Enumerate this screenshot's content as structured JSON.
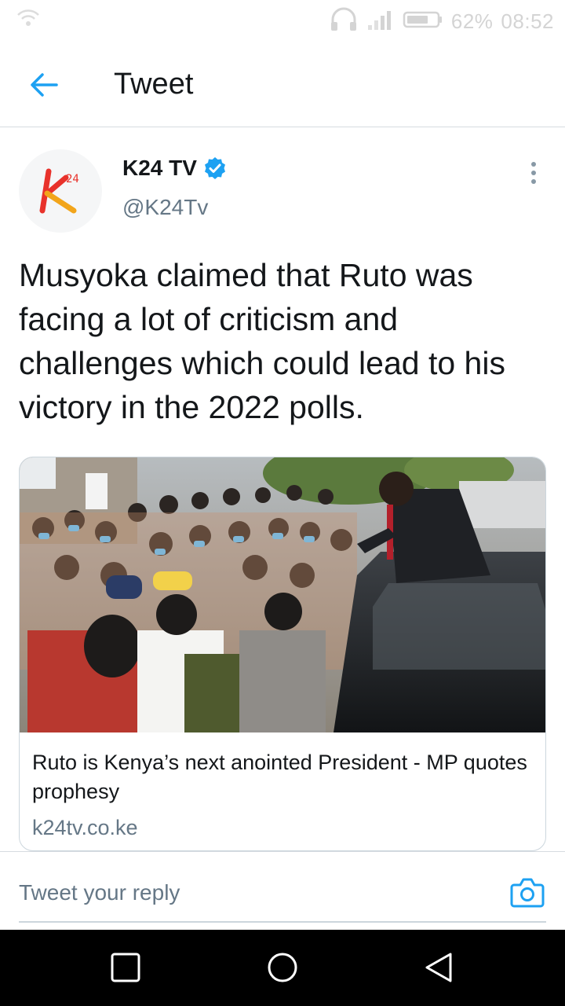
{
  "status_bar": {
    "battery": "62%",
    "time": "08:52",
    "icons": [
      "hotspot-icon",
      "headset-icon",
      "signal-icon",
      "battery-icon"
    ]
  },
  "header": {
    "title": "Tweet",
    "back_icon": "arrow-left-icon"
  },
  "tweet": {
    "author_name": "K24 TV",
    "author_handle": "@K24Tv",
    "verified": true,
    "avatar_logo_text": "24",
    "text": "Musyoka claimed that Ruto was facing a lot of criticism and challenges which could lead to his victory in the 2022 polls.",
    "card": {
      "title": "Ruto is Kenya’s next anointed President - MP quotes prophesy",
      "domain": "k24tv.co.ke"
    }
  },
  "reply": {
    "placeholder": "Tweet your reply",
    "camera_icon": "camera-icon"
  },
  "nav": {
    "icons": [
      "recents-square-icon",
      "home-circle-icon",
      "back-triangle-icon"
    ]
  },
  "colors": {
    "accent": "#1da1f2",
    "text": "#14171a",
    "secondary": "#657786",
    "divider": "#d6dbe0"
  }
}
